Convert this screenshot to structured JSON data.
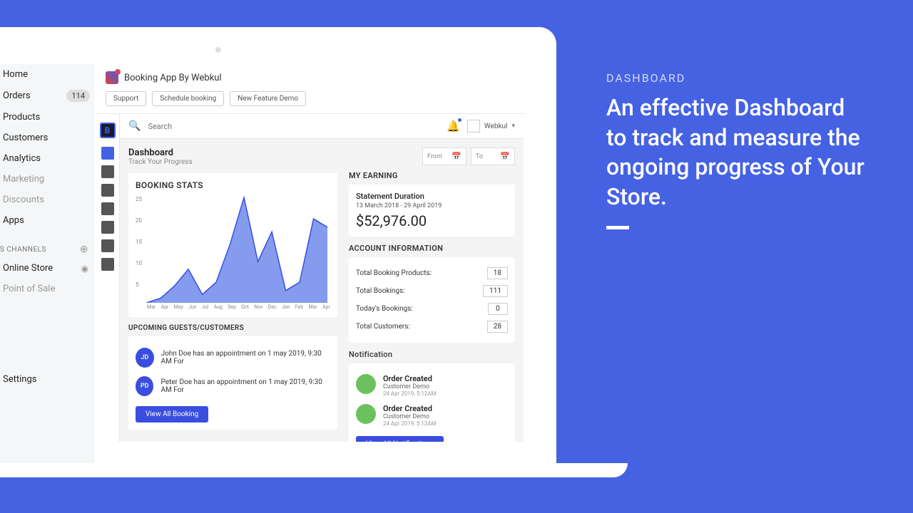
{
  "nav": {
    "home": "Home",
    "orders": "Orders",
    "orders_badge": "114",
    "products": "Products",
    "customers": "Customers",
    "analytics": "Analytics",
    "marketing": "Marketing",
    "discounts": "Discounts",
    "apps": "Apps",
    "channels_label": "S CHANNELS",
    "online_store": "Online Store",
    "pos": "Point of Sale",
    "settings": "Settings"
  },
  "app": {
    "title": "Booking App By Webkul",
    "btn_support": "Support",
    "btn_schedule": "Schedule booking",
    "btn_demo": "New Feature Demo"
  },
  "topbar": {
    "search_placeholder": "Search",
    "user": "Webkul"
  },
  "dashboard": {
    "title": "Dashboard",
    "subtitle": "Track Your Progress",
    "from_label": "From",
    "to_label": "To"
  },
  "stats": {
    "title": "BOOKING STATS"
  },
  "chart_data": {
    "type": "area",
    "categories": [
      "Mar",
      "Apr",
      "May",
      "Jun",
      "Jul",
      "Aug",
      "Sep",
      "Oct",
      "Nov",
      "Dec",
      "Jan",
      "Feb",
      "Mar",
      "Apr"
    ],
    "values": [
      0,
      1,
      4,
      8,
      2,
      5,
      14,
      25,
      10,
      17,
      3,
      5,
      20,
      18
    ],
    "ylabel": "",
    "xlabel": "",
    "ylim": [
      0,
      25
    ],
    "yticks": [
      0,
      5,
      10,
      15,
      20,
      25
    ]
  },
  "upcoming": {
    "title": "UPCOMING GUESTS/CUSTOMERS",
    "guests": [
      {
        "initials": "JD",
        "text": "John Doe has an appointment on 1 may 2019, 9:30 AM For"
      },
      {
        "initials": "PD",
        "text": "Peter Doe has an appointment on 1 may 2019, 9:30 AM For"
      }
    ],
    "view_all": "View All Booking"
  },
  "earning": {
    "title": "MY EARNING",
    "statement_label": "Statement Duration",
    "statement_range": "13 March 2018 - 29 April 2019",
    "amount": "$52,976.00"
  },
  "account": {
    "title": "ACCOUNT INFORMATION",
    "rows": [
      {
        "label": "Total Booking Products:",
        "value": "18"
      },
      {
        "label": "Total Bookings:",
        "value": "111"
      },
      {
        "label": "Today's Bookings:",
        "value": "0"
      },
      {
        "label": "Total Customers:",
        "value": "28"
      }
    ]
  },
  "notifications": {
    "title": "Notification",
    "items": [
      {
        "title": "Order Created",
        "sub": "Customer Demo",
        "time": "24 Apr 2019, 5:12AM"
      },
      {
        "title": "Order Created",
        "sub": "Customer Demo",
        "time": "24 Apr 2019, 5:12AM"
      }
    ],
    "view_all": "View All Notifications"
  },
  "promo": {
    "eyebrow": "DASHBOARD",
    "headline": "An effective Dashboard to track and measure the ongoing progress of Your Store."
  }
}
